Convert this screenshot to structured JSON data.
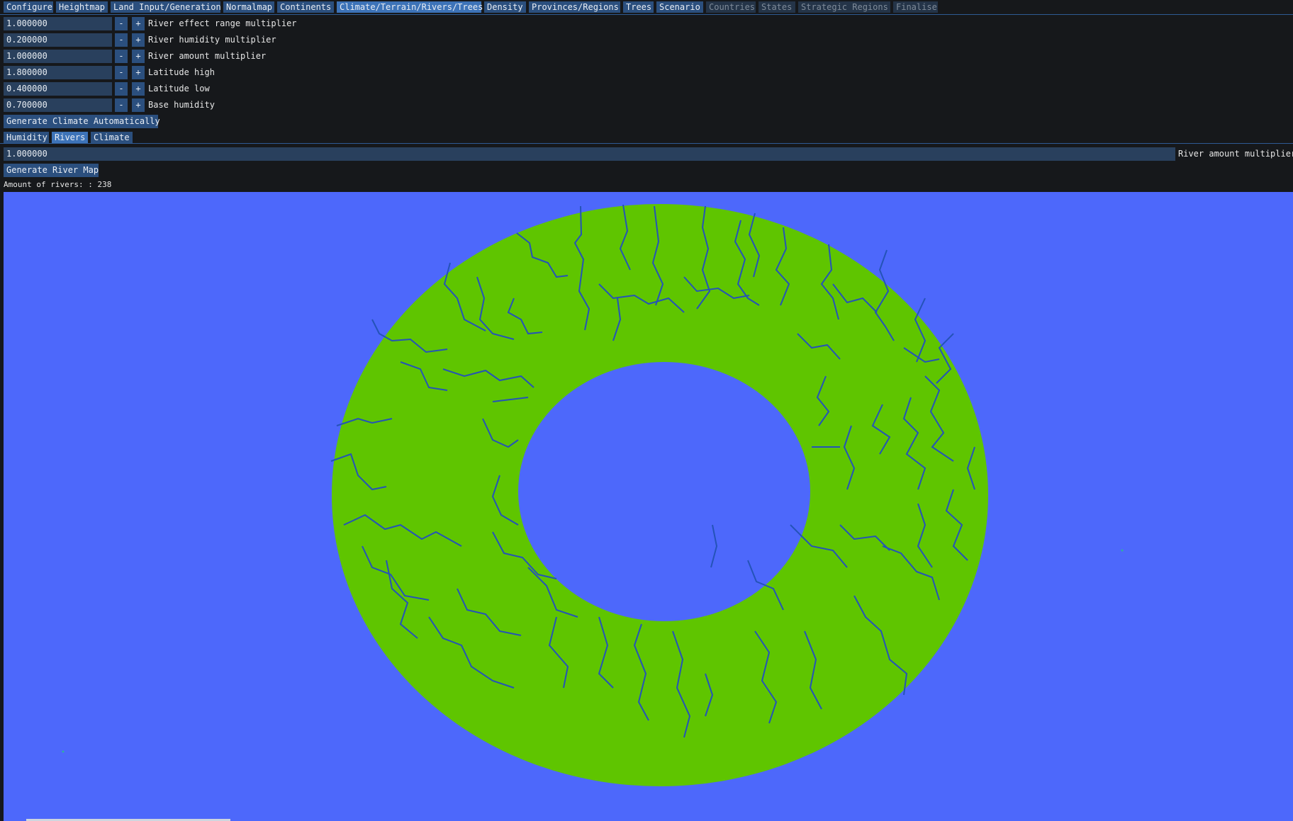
{
  "tabs": [
    {
      "label": "Configure",
      "state": "normal"
    },
    {
      "label": "Heightmap",
      "state": "normal"
    },
    {
      "label": "Land Input/Generation",
      "state": "normal"
    },
    {
      "label": "Normalmap",
      "state": "normal"
    },
    {
      "label": "Continents",
      "state": "normal"
    },
    {
      "label": "Climate/Terrain/Rivers/Trees",
      "state": "active"
    },
    {
      "label": "Density",
      "state": "normal"
    },
    {
      "label": "Provinces/Regions",
      "state": "normal"
    },
    {
      "label": "Trees",
      "state": "normal"
    },
    {
      "label": "Scenario",
      "state": "normal"
    },
    {
      "label": "Countries",
      "state": "disabled"
    },
    {
      "label": "States",
      "state": "disabled"
    },
    {
      "label": "Strategic Regions",
      "state": "disabled"
    },
    {
      "label": "Finalise",
      "state": "disabled"
    }
  ],
  "params": [
    {
      "value": "1.000000",
      "label": "River effect range multiplier"
    },
    {
      "value": "0.200000",
      "label": "River humidity multiplier"
    },
    {
      "value": "1.000000",
      "label": "River amount multiplier"
    },
    {
      "value": "1.800000",
      "label": "Latitude high"
    },
    {
      "value": "0.400000",
      "label": "Latitude low"
    },
    {
      "value": "0.700000",
      "label": "Base humidity"
    }
  ],
  "stepper": {
    "minus": "-",
    "plus": "+"
  },
  "generate_climate_label": "Generate Climate Automatically",
  "subtabs": [
    {
      "label": "Humidity",
      "state": "normal"
    },
    {
      "label": "Rivers",
      "state": "active"
    },
    {
      "label": "Climate",
      "state": "normal"
    }
  ],
  "river_amount": {
    "value": "1.000000",
    "label": "River amount multiplier"
  },
  "generate_river_map_label": "Generate River Map",
  "rivers_info": "Amount of rivers: : 238",
  "colors": {
    "water": "#4d68fb",
    "land": "#5fc500",
    "river": "#2453b8",
    "tab": "#2b4f7e",
    "tab_active": "#3d73b8"
  }
}
